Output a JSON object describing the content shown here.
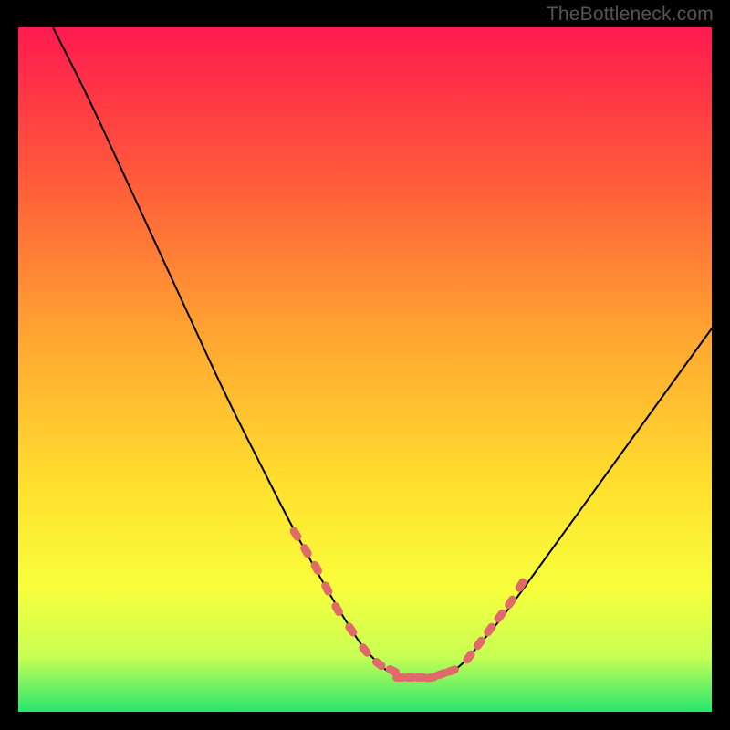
{
  "watermark": "TheBottleneck.com",
  "chart_data": {
    "type": "line",
    "title": "",
    "xlabel": "",
    "ylabel": "",
    "xlim": [
      0,
      100
    ],
    "ylim": [
      0,
      100
    ],
    "grid": false,
    "legend": null,
    "background_gradient": {
      "type": "vertical",
      "stops": [
        {
          "pos": 0.0,
          "color": "#ff1a4f"
        },
        {
          "pos": 0.22,
          "color": "#ff5a3a"
        },
        {
          "pos": 0.45,
          "color": "#ffa531"
        },
        {
          "pos": 0.68,
          "color": "#ffe22e"
        },
        {
          "pos": 0.82,
          "color": "#f8ff3b"
        },
        {
          "pos": 0.92,
          "color": "#c7ff54"
        },
        {
          "pos": 1.0,
          "color": "#26e66f"
        }
      ]
    },
    "series": [
      {
        "name": "curve",
        "style": "line",
        "color": "#000000",
        "x": [
          5,
          10,
          15,
          20,
          25,
          30,
          35,
          40,
          45,
          48,
          50,
          53,
          55,
          58,
          60,
          63,
          65,
          70,
          75,
          80,
          85,
          90,
          95,
          100
        ],
        "values": [
          100,
          90,
          79,
          68,
          57,
          46,
          36,
          26,
          17,
          12,
          9,
          6,
          5,
          5,
          5,
          6,
          8,
          14,
          21,
          28,
          35,
          42,
          49,
          56
        ]
      },
      {
        "name": "markers-left",
        "style": "markers",
        "marker_type": "rounded-dash",
        "color": "#e06a6a",
        "x": [
          40,
          41.5,
          43,
          44.5,
          46,
          48,
          50,
          52,
          54
        ],
        "values": [
          26,
          23.5,
          21,
          18,
          15,
          12,
          9,
          7,
          6
        ]
      },
      {
        "name": "markers-bottom",
        "style": "markers",
        "marker_type": "rounded-dash",
        "color": "#e06a6a",
        "x": [
          55,
          56.5,
          58,
          59.5,
          61,
          62.5
        ],
        "values": [
          5,
          5,
          5,
          5,
          5.5,
          6
        ]
      },
      {
        "name": "markers-right",
        "style": "markers",
        "marker_type": "rounded-dash",
        "color": "#e06a6a",
        "x": [
          65,
          66.5,
          68,
          69.5,
          71,
          72.5
        ],
        "values": [
          8,
          10,
          12,
          14,
          16,
          18.5
        ]
      }
    ]
  }
}
